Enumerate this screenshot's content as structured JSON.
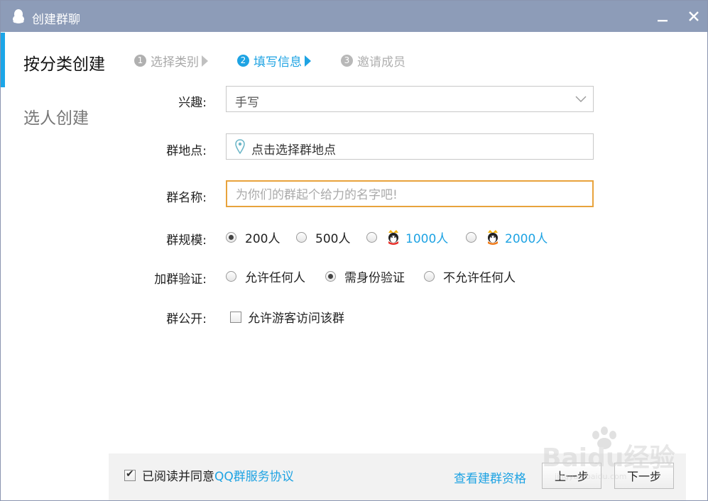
{
  "window": {
    "title": "创建群聊"
  },
  "sidebar": {
    "items": [
      {
        "label": "按分类创建",
        "active": true
      },
      {
        "label": "选人创建",
        "active": false
      }
    ]
  },
  "steps": [
    {
      "num": "1",
      "label": "选择类别",
      "state": "done"
    },
    {
      "num": "2",
      "label": "填写信息",
      "state": "current"
    },
    {
      "num": "3",
      "label": "邀请成员",
      "state": "pending"
    }
  ],
  "form": {
    "interest": {
      "label": "兴趣:",
      "value": "手写"
    },
    "location": {
      "label": "群地点:",
      "value": "点击选择群地点"
    },
    "name": {
      "label": "群名称:",
      "placeholder": "为你们的群起个给力的名字吧!",
      "value": ""
    },
    "size": {
      "label": "群规模:",
      "options": [
        {
          "label": "200人",
          "selected": true,
          "vip": false
        },
        {
          "label": "500人",
          "selected": false,
          "vip": false
        },
        {
          "label": "1000人",
          "selected": false,
          "vip": true
        },
        {
          "label": "2000人",
          "selected": false,
          "vip": true
        }
      ]
    },
    "verify": {
      "label": "加群验证:",
      "options": [
        {
          "label": "允许任何人",
          "selected": false
        },
        {
          "label": "需身份验证",
          "selected": true
        },
        {
          "label": "不允许任何人",
          "selected": false
        }
      ]
    },
    "public": {
      "label": "群公开:",
      "checkbox_label": "允许游客访问该群",
      "checked": false
    }
  },
  "footer": {
    "agree_prefix": "已阅读并同意",
    "agree_link": "QQ群服务协议",
    "agree_checked": true,
    "qualification_link": "查看建群资格",
    "prev_label": "上一步",
    "next_label": "下一步"
  },
  "watermark": {
    "text": "Baidu经验",
    "sub": "jingyan.baidu.com"
  },
  "colors": {
    "titlebar": "#8d9cb8",
    "accent": "#1ea3e3",
    "focus_border": "#e8a33c"
  }
}
